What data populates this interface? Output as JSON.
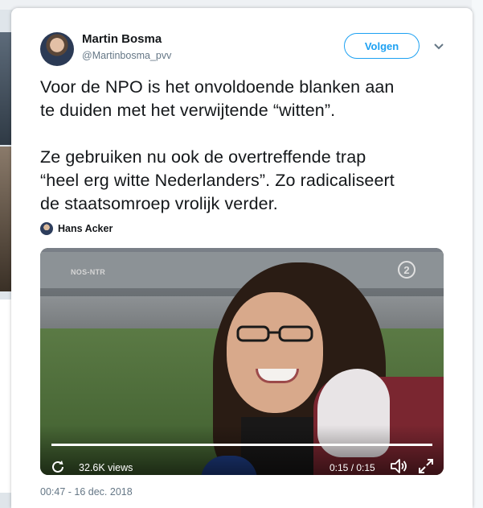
{
  "tweet": {
    "author_name": "Martin Bosma",
    "author_handle": "@Martinbosma_pvv",
    "follow_label": "Volgen",
    "text_lines": [
      "Voor de NPO is het onvoldoende blanken aan",
      "te duiden met het verwijtende “witten”.",
      "Ze gebruiken nu ook de overtreffende trap",
      "“heel erg witte Nederlanders”. Zo radicaliseert",
      "de staatsomroep vrolijk verder."
    ],
    "mention_name": "Hans Acker",
    "timestamp": "00:47 - 16 dec. 2018"
  },
  "video": {
    "watermark": "NOS-NTR",
    "views": "32.6K views",
    "time": "0:15 / 0:15",
    "progress": 1.0
  },
  "colors": {
    "accent": "#1da1f2",
    "text": "#14171a",
    "muted": "#657786"
  },
  "icons": [
    "chevron-down-icon",
    "replay-icon",
    "volume-icon",
    "fullscreen-icon"
  ]
}
